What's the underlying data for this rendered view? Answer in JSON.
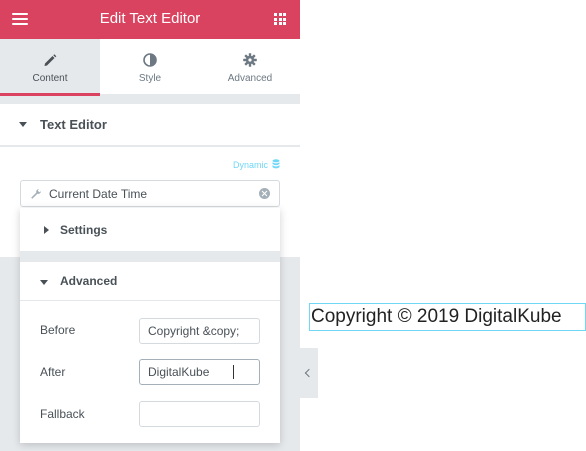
{
  "header": {
    "title": "Edit Text Editor",
    "menu_icon": "hamburger-icon",
    "widgets_icon": "grid-icon",
    "accent_color": "#d9435f"
  },
  "tabs": [
    {
      "label": "Content",
      "icon": "pencil-icon",
      "active": true
    },
    {
      "label": "Style",
      "icon": "half-circle-icon",
      "active": false
    },
    {
      "label": "Advanced",
      "icon": "gear-icon",
      "active": false
    }
  ],
  "section": {
    "title": "Text Editor",
    "dynamic_label": "Dynamic",
    "dynamic_color": "#71d7f7",
    "dynamic_tag": "Current Date Time"
  },
  "popover": {
    "settings_label": "Settings",
    "advanced_label": "Advanced",
    "fields": [
      {
        "label": "Before",
        "value": "Copyright &copy;",
        "placeholder": ""
      },
      {
        "label": "After",
        "value": "DigitalKube",
        "placeholder": ""
      },
      {
        "label": "Fallback",
        "value": "",
        "placeholder": ""
      }
    ]
  },
  "preview": {
    "text": "Copyright © 2019 DigitalKube",
    "outline_color": "#71d7f7"
  }
}
